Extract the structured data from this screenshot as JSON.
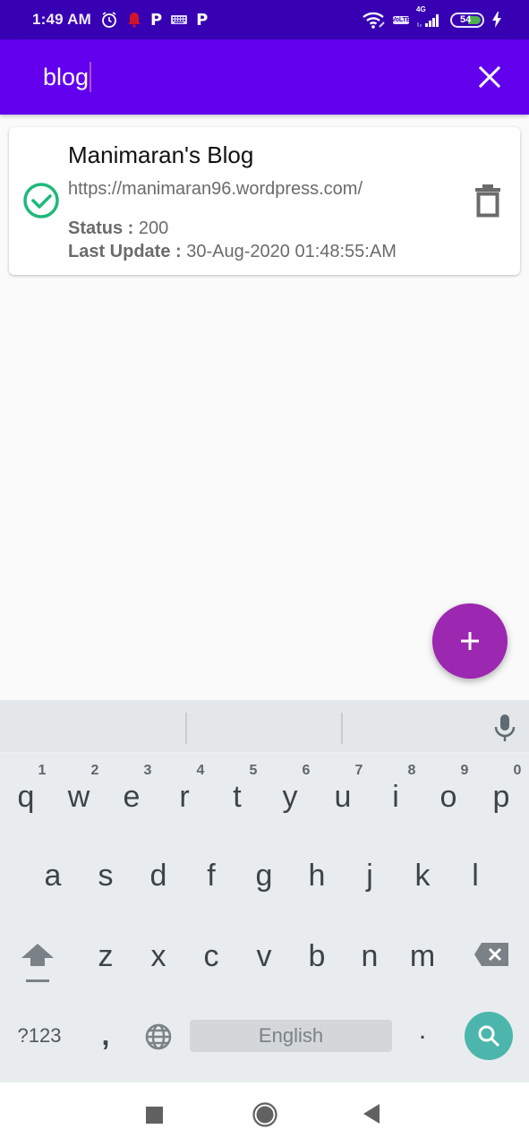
{
  "status_bar": {
    "time": "1:49 AM",
    "left_icons": [
      "alarm-icon",
      "notification-bell-icon",
      "p-app-icon",
      "keyboard-icon",
      "p-app-icon"
    ],
    "network_label": "4G",
    "volte_label_top": "Vo",
    "volte_label_bottom": "LTE",
    "battery_level": "54",
    "charging": true
  },
  "search": {
    "query": "blog",
    "clear_icon": "close-icon"
  },
  "colors": {
    "status_bar": "#3700b3",
    "app_bar": "#6200ee",
    "fab": "#9c27b0",
    "success": "#1db97a",
    "search_key": "#4db6ac"
  },
  "sites": [
    {
      "name": "Manimaran's Blog",
      "url": "https://manimaran96.wordpress.com/",
      "status_label": "Status :",
      "status_value": "200",
      "last_update_label": "Last Update :",
      "last_update_value": "30-Aug-2020 01:48:55:AM",
      "state_icon": "check-circle-icon",
      "delete_icon": "trash-icon"
    }
  ],
  "fab": {
    "icon": "plus-icon",
    "label": "+"
  },
  "keyboard": {
    "row1": [
      {
        "key": "q",
        "hint": "1"
      },
      {
        "key": "w",
        "hint": "2"
      },
      {
        "key": "e",
        "hint": "3"
      },
      {
        "key": "r",
        "hint": "4"
      },
      {
        "key": "t",
        "hint": "5"
      },
      {
        "key": "y",
        "hint": "6"
      },
      {
        "key": "u",
        "hint": "7"
      },
      {
        "key": "i",
        "hint": "8"
      },
      {
        "key": "o",
        "hint": "9"
      },
      {
        "key": "p",
        "hint": "0"
      }
    ],
    "row2": [
      "a",
      "s",
      "d",
      "f",
      "g",
      "h",
      "j",
      "k",
      "l"
    ],
    "row3": [
      "z",
      "x",
      "c",
      "v",
      "b",
      "n",
      "m"
    ],
    "symbols_key": "?123",
    "comma_key": ",",
    "space_label": "English",
    "period_key": "."
  },
  "nav_bar": {
    "recents": "recents-icon",
    "home": "home-icon",
    "back": "back-icon"
  }
}
